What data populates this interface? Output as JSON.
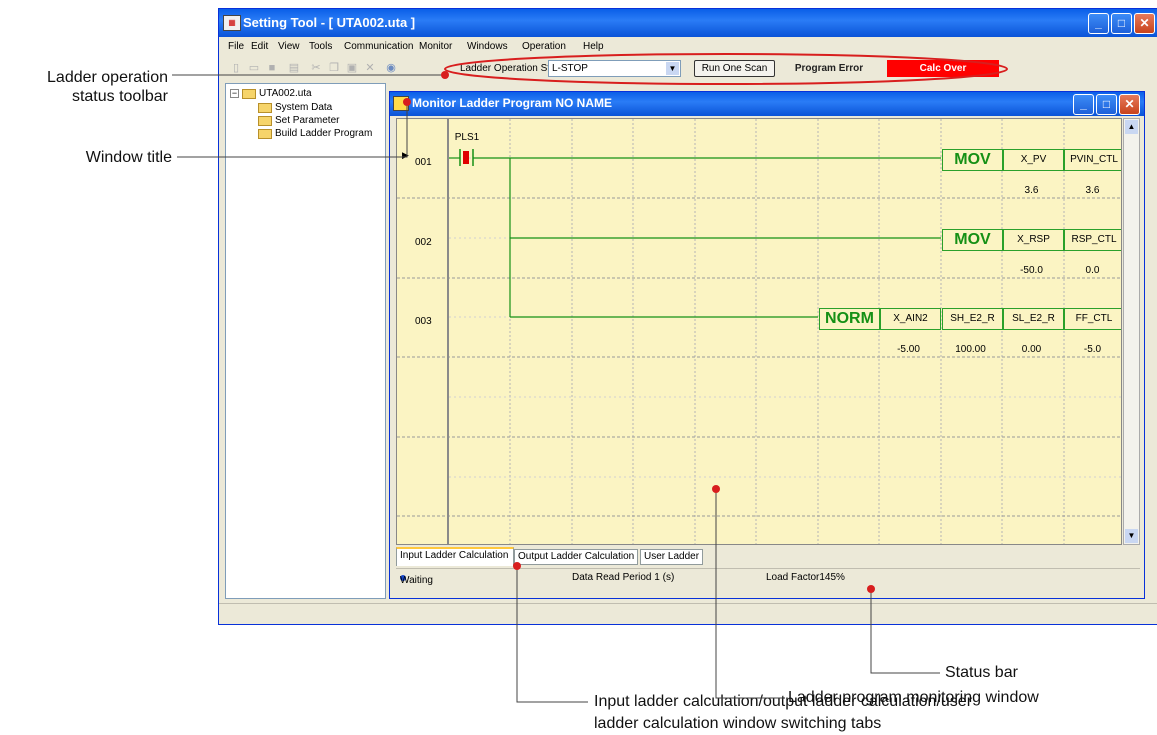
{
  "annotations": {
    "status_toolbar": "Ladder operation\nstatus toolbar",
    "window_title": "Window title",
    "status_bar": "Status bar",
    "monitor_window": "Ladder program monitoring window",
    "tabs_line1": "Input ladder calculation/output ladder calculation/user",
    "tabs_line2": "ladder calculation window switching tabs"
  },
  "app": {
    "title": "Setting Tool - [ UTA002.uta ]",
    "menu": [
      "File",
      "Edit",
      "View",
      "Tools",
      "Communication",
      "Monitor",
      "Windows",
      "Operation",
      "Help"
    ]
  },
  "toolbar": {
    "status_label": "Ladder Operation Status:",
    "status_value": "L-STOP",
    "run_button": "Run One Scan",
    "program_error": "Program Error",
    "calc_over": "Calc Over",
    "calc_over_color": "#ff0000"
  },
  "tree": {
    "root": "UTA002.uta",
    "items": [
      "System Data",
      "Set Parameter",
      "Build Ladder Program"
    ]
  },
  "child": {
    "title": "Monitor Ladder Program NO NAME",
    "tabs": [
      "Input Ladder Calculation",
      "Output Ladder Calculation",
      "User Ladder"
    ],
    "status": {
      "state": "Waiting",
      "period": "Data Read Period 1 (s)",
      "load": "Load Factor145%"
    }
  },
  "ladder": {
    "contact": "PLS1",
    "rows": [
      {
        "num": "001",
        "instr": "MOV",
        "args": [
          "X_PV",
          "PVIN_CTL"
        ],
        "values": [
          "3.6",
          "3.6"
        ]
      },
      {
        "num": "002",
        "instr": "MOV",
        "args": [
          "X_RSP",
          "RSP_CTL"
        ],
        "values": [
          "-50.0",
          "0.0"
        ]
      },
      {
        "num": "003",
        "instr": "NORM",
        "args": [
          "X_AIN2",
          "SH_E2_R",
          "SL_E2_R",
          "FF_CTL"
        ],
        "values": [
          "-5.00",
          "100.00",
          "0.00",
          "-5.0"
        ]
      }
    ]
  }
}
